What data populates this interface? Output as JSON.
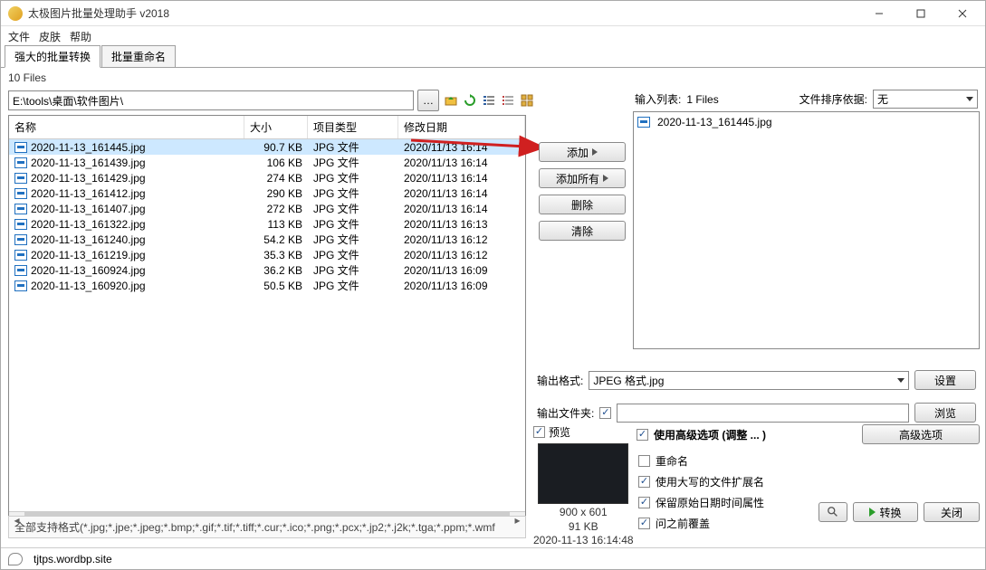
{
  "window": {
    "title": "太极图片批量处理助手  v2018"
  },
  "menu": {
    "file": "文件",
    "skin": "皮肤",
    "help": "帮助"
  },
  "tabs": {
    "batch": "强大的批量转换",
    "rename": "批量重命名"
  },
  "filesCount": "10 Files",
  "path": "E:\\tools\\桌面\\软件图片\\",
  "columns": {
    "name": "名称",
    "size": "大小",
    "type": "项目类型",
    "date": "修改日期"
  },
  "files": [
    {
      "name": "2020-11-13_161445.jpg",
      "size": "90.7 KB",
      "type": "JPG 文件",
      "date": "2020/11/13 16:14",
      "selected": true
    },
    {
      "name": "2020-11-13_161439.jpg",
      "size": "106 KB",
      "type": "JPG 文件",
      "date": "2020/11/13 16:14"
    },
    {
      "name": "2020-11-13_161429.jpg",
      "size": "274 KB",
      "type": "JPG 文件",
      "date": "2020/11/13 16:14"
    },
    {
      "name": "2020-11-13_161412.jpg",
      "size": "290 KB",
      "type": "JPG 文件",
      "date": "2020/11/13 16:14"
    },
    {
      "name": "2020-11-13_161407.jpg",
      "size": "272 KB",
      "type": "JPG 文件",
      "date": "2020/11/13 16:14"
    },
    {
      "name": "2020-11-13_161322.jpg",
      "size": "113 KB",
      "type": "JPG 文件",
      "date": "2020/11/13 16:13"
    },
    {
      "name": "2020-11-13_161240.jpg",
      "size": "54.2 KB",
      "type": "JPG 文件",
      "date": "2020/11/13 16:12"
    },
    {
      "name": "2020-11-13_161219.jpg",
      "size": "35.3 KB",
      "type": "JPG 文件",
      "date": "2020/11/13 16:12"
    },
    {
      "name": "2020-11-13_160924.jpg",
      "size": "36.2 KB",
      "type": "JPG 文件",
      "date": "2020/11/13 16:09"
    },
    {
      "name": "2020-11-13_160920.jpg",
      "size": "50.5 KB",
      "type": "JPG 文件",
      "date": "2020/11/13 16:09"
    }
  ],
  "formats": "全部支持格式(*.jpg;*.jpe;*.jpeg;*.bmp;*.gif;*.tif;*.tiff;*.cur;*.ico;*.png;*.pcx;*.jp2;*.j2k;*.tga;*.ppm;*.wmf",
  "status": {
    "url": "tjtps.wordbp.site"
  },
  "right": {
    "inlistLabel": "输入列表:",
    "inlistCount": "1 Files",
    "sortLabel": "文件排序依据:",
    "sortValue": "无",
    "outListItem": "2020-11-13_161445.jpg",
    "addBtn": "添加",
    "addAllBtn": "添加所有",
    "deleteBtn": "删除",
    "clearBtn": "清除",
    "outFormatLabel": "输出格式:",
    "outFormatValue": "JPEG 格式.jpg",
    "settingsBtn": "设置",
    "outFolderLabel": "输出文件夹:",
    "browseBtn": "浏览"
  },
  "preview": {
    "label": "预览",
    "dim": "900 x 601",
    "size": "91 KB",
    "date": "2020-11-13 16:14:48"
  },
  "adv": {
    "headerLabel": "使用高级选项 (调整 ... )",
    "btn": "高级选项",
    "rename": "重命名",
    "upperExt": "使用大写的文件扩展名",
    "keepDate": "保留原始日期时间属性",
    "askOverwrite": "问之前覆盖"
  },
  "bottom": {
    "convert": "转换",
    "close": "关闭"
  }
}
